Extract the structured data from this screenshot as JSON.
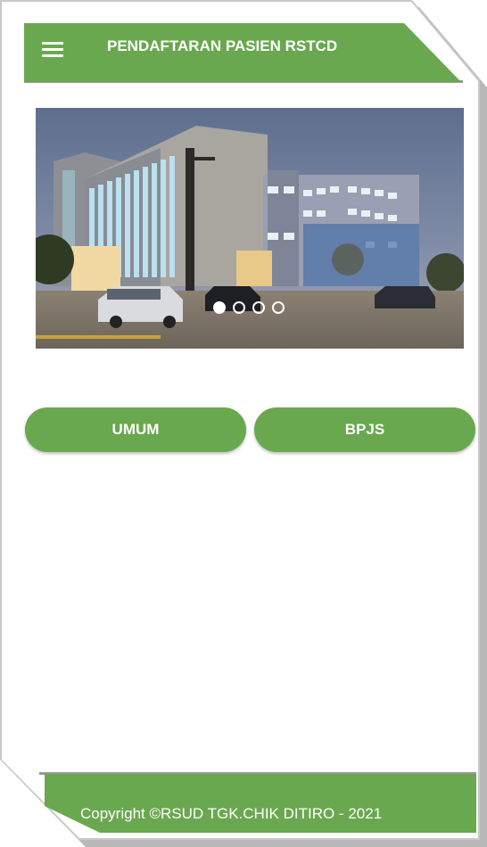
{
  "header": {
    "title": "PENDAFTARAN PASIEN RSTCD",
    "menu_icon": "hamburger-menu-icon"
  },
  "carousel": {
    "slide_count": 4,
    "active_index": 0
  },
  "buttons": {
    "umum_label": "UMUM",
    "bpjs_label": "BPJS"
  },
  "footer": {
    "copyright": "Copyright ©RSUD TGK.CHIK DITIRO - 2021"
  },
  "colors": {
    "accent": "#6aa84f",
    "background": "#ffffff"
  }
}
